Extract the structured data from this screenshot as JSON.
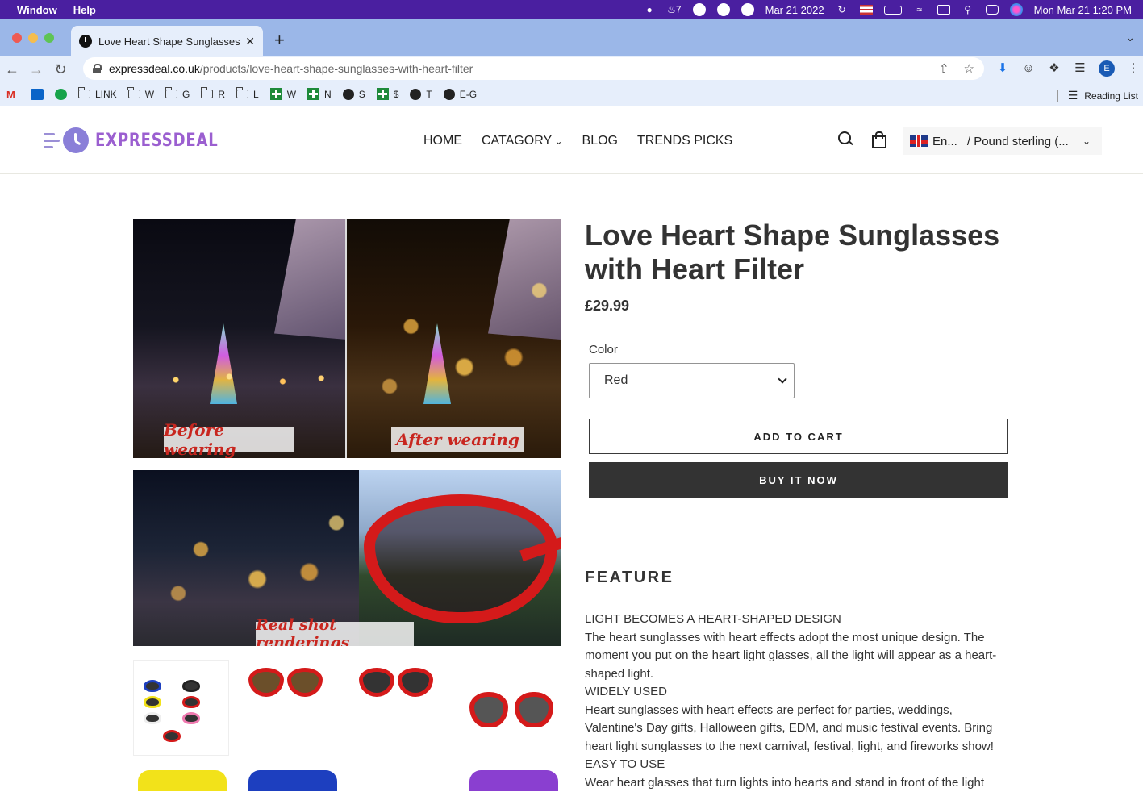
{
  "menubar": {
    "items": [
      "Window",
      "Help"
    ],
    "date": "Mar 21 2022",
    "notification_count": "7",
    "datetime": "Mon Mar 21  1:20 PM"
  },
  "browser": {
    "tab_title": "Love Heart Shape Sunglasses w",
    "url_host": "expressdeal.co.uk",
    "url_path": "/products/love-heart-shape-sunglasses-with-heart-filter",
    "profile_initial": "E",
    "bookmarks": [
      "LINK",
      "W",
      "G",
      "R",
      "L",
      "W",
      "N",
      "S",
      "$",
      "T",
      "E-G"
    ],
    "reading_list": "Reading List"
  },
  "site": {
    "logo_text": "EXPRESSDEAL",
    "nav": [
      "HOME",
      "CATAGORY",
      "BLOG",
      "TRENDS PICKS"
    ],
    "language": "En...",
    "currency": "/ Pound sterling (..."
  },
  "gallery": {
    "caption_before": "Before wearing",
    "caption_after": "After wearing",
    "caption_real": "Real shot renderings"
  },
  "product": {
    "title": "Love Heart Shape Sunglasses with Heart Filter",
    "price": "£29.99",
    "option_label": "Color",
    "option_value": "Red",
    "add_to_cart": "ADD TO CART",
    "buy_now": "BUY IT NOW",
    "feature_heading": "FEATURE",
    "description": [
      "LIGHT BECOMES A HEART-SHAPED DESIGN",
      "The heart sunglasses with heart effects adopt the most unique design. The moment you put on the heart light glasses, all the light will appear as a heart-shaped light.",
      "WIDELY USED",
      "Heart sunglasses with heart effects are perfect for parties, weddings, Valentine's Day gifts, Halloween gifts, EDM, and music festival events. Bring heart light sunglasses to the next carnival, festival, light, and fireworks show!",
      "EASY TO USE",
      "Wear heart glasses that turn lights into hearts and stand in front of the light"
    ]
  },
  "colors": {
    "menubar": "#4a1fa0",
    "tabbar": "#9bb7e8",
    "accent_logo": "#9b5fd0",
    "buy_button": "#333333",
    "caption_red": "#c8261f"
  }
}
